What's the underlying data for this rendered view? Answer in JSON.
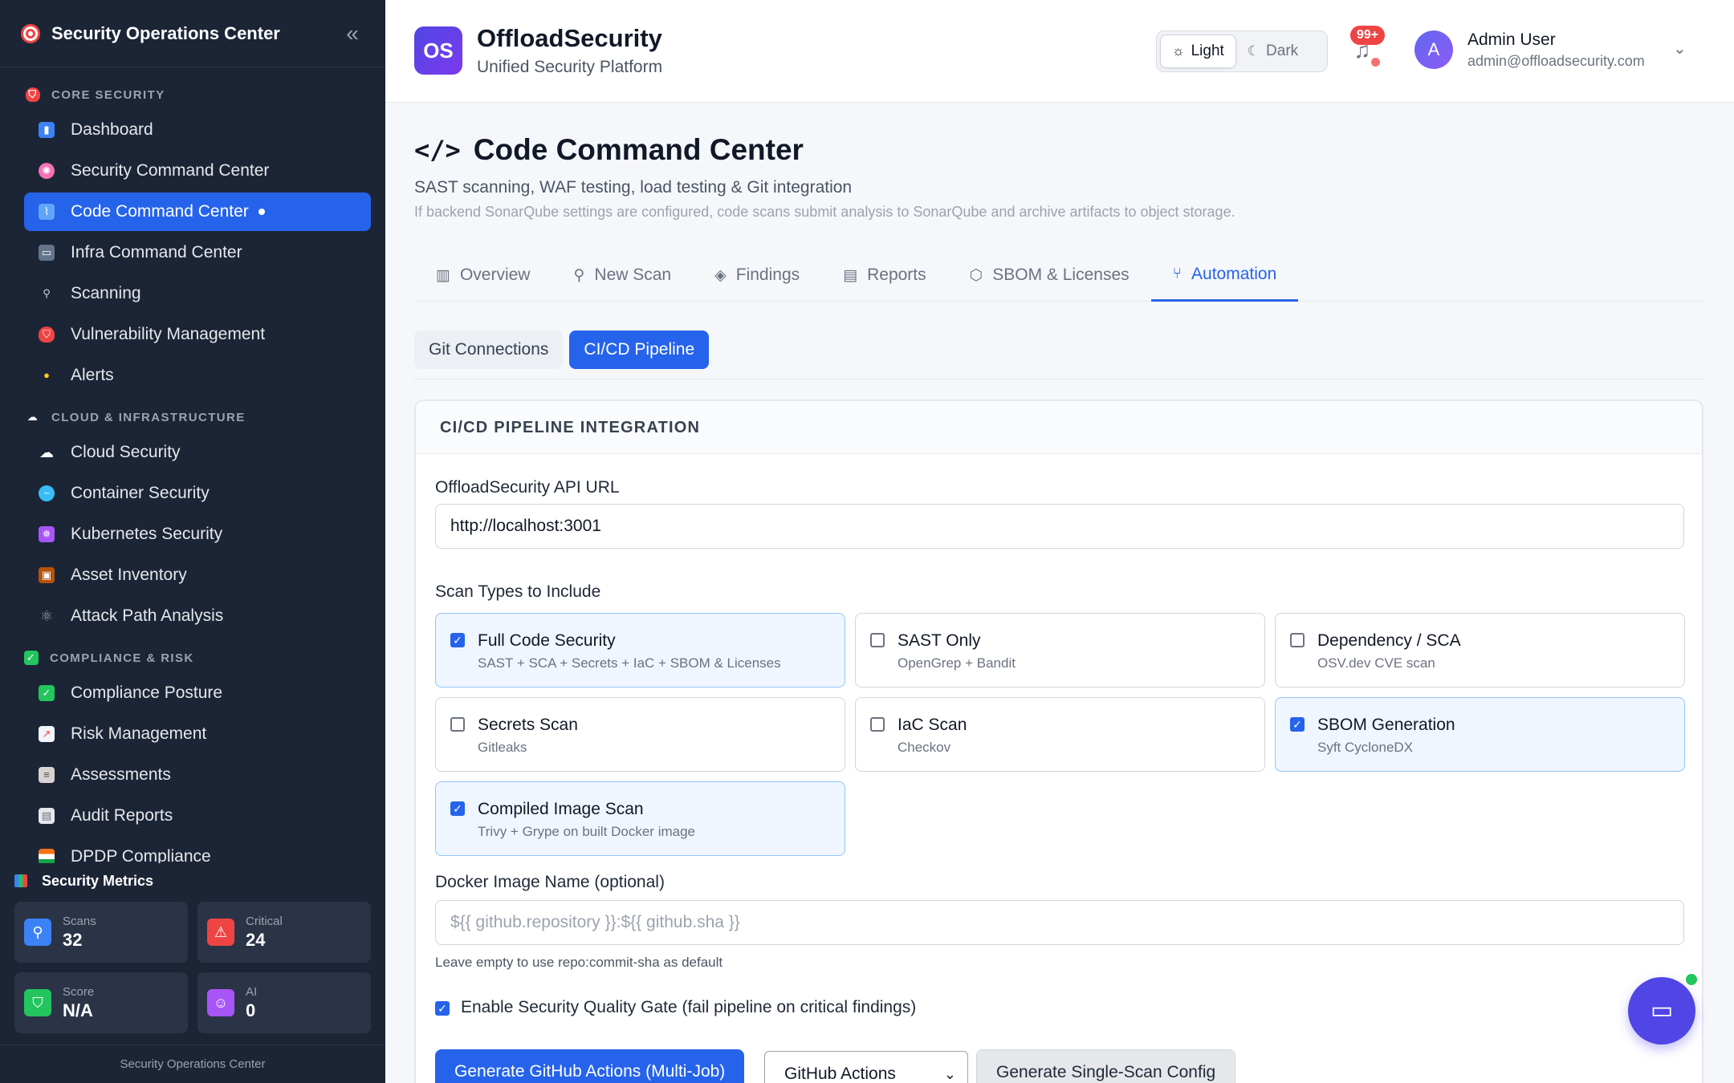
{
  "sidebar": {
    "title": "Security Operations Center",
    "sections": [
      {
        "label": "CORE SECURITY",
        "icon": "shield-icon",
        "items": [
          {
            "label": "Dashboard",
            "icon": "bar-chart-icon"
          },
          {
            "label": "Security Command Center",
            "icon": "brain-icon"
          },
          {
            "label": "Code Command Center",
            "icon": "dna-icon",
            "active": true
          },
          {
            "label": "Infra Command Center",
            "icon": "monitor-icon"
          },
          {
            "label": "Scanning",
            "icon": "magnifier-icon"
          },
          {
            "label": "Vulnerability Management",
            "icon": "shield-icon"
          },
          {
            "label": "Alerts",
            "icon": "bell-icon"
          }
        ]
      },
      {
        "label": "CLOUD & INFRASTRUCTURE",
        "icon": "cloud-icon",
        "items": [
          {
            "label": "Cloud Security",
            "icon": "cloud-icon"
          },
          {
            "label": "Container Security",
            "icon": "whale-icon"
          },
          {
            "label": "Kubernetes Security",
            "icon": "helm-icon"
          },
          {
            "label": "Asset Inventory",
            "icon": "package-icon"
          },
          {
            "label": "Attack Path Analysis",
            "icon": "atom-icon"
          }
        ]
      },
      {
        "label": "COMPLIANCE & RISK",
        "icon": "check-box-icon",
        "items": [
          {
            "label": "Compliance Posture",
            "icon": "check-box-icon"
          },
          {
            "label": "Risk Management",
            "icon": "trend-chart-icon"
          },
          {
            "label": "Assessments",
            "icon": "clipboard-icon"
          },
          {
            "label": "Audit Reports",
            "icon": "document-icon"
          },
          {
            "label": "DPDP Compliance",
            "icon": "india-flag-icon"
          }
        ]
      }
    ],
    "metrics": {
      "title": "Security Metrics",
      "cards": [
        {
          "label": "Scans",
          "value": "32",
          "icon": "magnifier-icon",
          "color": "#3b82f6"
        },
        {
          "label": "Critical",
          "value": "24",
          "icon": "warning-icon",
          "color": "#ef4444"
        },
        {
          "label": "Score",
          "value": "N/A",
          "icon": "shield-icon",
          "color": "#22c55e"
        },
        {
          "label": "AI",
          "value": "0",
          "icon": "robot-icon",
          "color": "#a855f7"
        }
      ]
    },
    "footer": "Security Operations Center"
  },
  "topbar": {
    "logo_text": "OS",
    "brand_name": "OffloadSecurity",
    "brand_sub": "Unified Security Platform",
    "theme_light": "Light",
    "theme_dark": "Dark",
    "notif_count": "99+",
    "avatar_letter": "A",
    "user_name": "Admin User",
    "user_email": "admin@offloadsecurity.com"
  },
  "page": {
    "title": "Code Command Center",
    "subtitle": "SAST scanning, WAF testing, load testing & Git integration",
    "note": "If backend SonarQube settings are configured, code scans submit analysis to SonarQube and archive artifacts to object storage.",
    "tabs": [
      {
        "label": "Overview",
        "icon": "bar-chart-icon"
      },
      {
        "label": "New Scan",
        "icon": "search-icon"
      },
      {
        "label": "Findings",
        "icon": "layers-icon"
      },
      {
        "label": "Reports",
        "icon": "clipboard-icon"
      },
      {
        "label": "SBOM & Licenses",
        "icon": "box-icon"
      },
      {
        "label": "Automation",
        "icon": "git-branch-icon",
        "active": true
      }
    ],
    "subtabs": [
      {
        "label": "Git Connections"
      },
      {
        "label": "CI/CD Pipeline",
        "active": true
      }
    ]
  },
  "panel": {
    "title": "CI/CD PIPELINE INTEGRATION",
    "api_label": "OffloadSecurity API URL",
    "api_value": "http://localhost:3001",
    "scan_types_label": "Scan Types to Include",
    "scan_types": [
      {
        "title": "Full Code Security",
        "desc": "SAST + SCA + Secrets + IaC + SBOM & Licenses",
        "checked": true
      },
      {
        "title": "SAST Only",
        "desc": "OpenGrep + Bandit",
        "checked": false
      },
      {
        "title": "Dependency / SCA",
        "desc": "OSV.dev CVE scan",
        "checked": false
      },
      {
        "title": "Secrets Scan",
        "desc": "Gitleaks",
        "checked": false
      },
      {
        "title": "IaC Scan",
        "desc": "Checkov",
        "checked": false
      },
      {
        "title": "SBOM Generation",
        "desc": "Syft CycloneDX",
        "checked": true
      },
      {
        "title": "Compiled Image Scan",
        "desc": "Trivy + Grype on built Docker image",
        "checked": true
      }
    ],
    "docker_label": "Docker Image Name (optional)",
    "docker_placeholder": "${{ github.repository }}:${{ github.sha }}",
    "docker_hint": "Leave empty to use repo:commit-sha as default",
    "gate_label": "Enable Security Quality Gate (fail pipeline on critical findings)",
    "gate_checked": true,
    "generate_multi": "Generate GitHub Actions (Multi-Job)",
    "platform_selected": "GitHub Actions",
    "generate_single": "Generate Single-Scan Config"
  },
  "colors": {
    "accent": "#2563eb",
    "sidebar_bg": "#1c2536",
    "danger": "#ef4444",
    "success": "#22c55e"
  }
}
